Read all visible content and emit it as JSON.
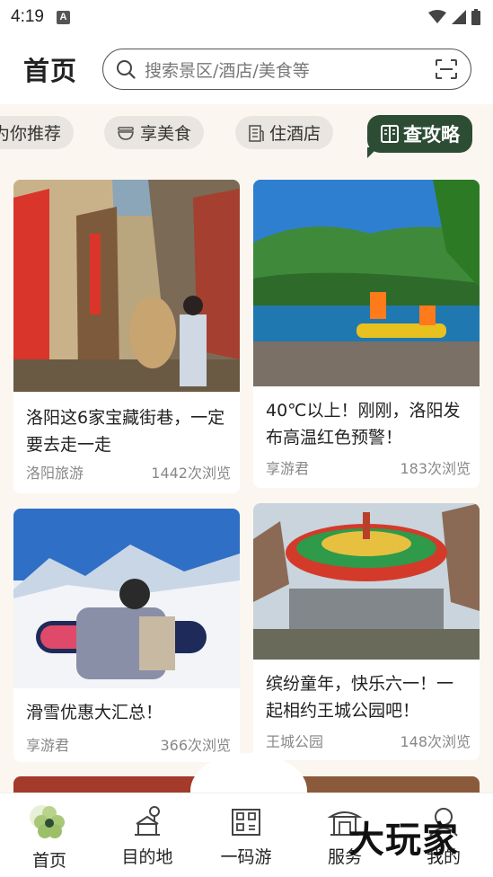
{
  "status_bar": {
    "time": "4:19",
    "notification_letter": "A"
  },
  "header": {
    "title": "首页",
    "search_placeholder": "搜索景区/酒店/美食等"
  },
  "chips": [
    {
      "label": "为你推荐",
      "icon": "recommend-icon"
    },
    {
      "label": "享美食",
      "icon": "food-bowl-icon"
    },
    {
      "label": "住酒店",
      "icon": "hotel-building-icon"
    },
    {
      "label": "查攻略",
      "icon": "guidebook-icon",
      "active": true
    }
  ],
  "cards": [
    {
      "title": "洛阳这6家宝藏街巷，一定要去走一走",
      "source": "洛阳旅游",
      "views": "1442次浏览"
    },
    {
      "title": "40℃以上！刚刚，洛阳发布高温红色预警！",
      "source": "享游君",
      "views": "183次浏览"
    },
    {
      "title": "滑雪优惠大汇总！",
      "source": "享游君",
      "views": "366次浏览"
    },
    {
      "title": "缤纷童年，快乐六一！一起相约王城公园吧！",
      "source": "王城公园",
      "views": "148次浏览"
    }
  ],
  "bottom_nav": [
    {
      "label": "首页",
      "icon": "home-flower-icon",
      "active": true
    },
    {
      "label": "目的地",
      "icon": "destination-icon"
    },
    {
      "label": "一码游",
      "icon": "qr-tour-icon"
    },
    {
      "label": "服务",
      "icon": "service-pavilion-icon"
    },
    {
      "label": "我的",
      "icon": "profile-icon"
    }
  ],
  "watermark": "大玩家",
  "colors": {
    "accent": "#2d4c34",
    "background": "#fbf7f0",
    "chip": "#e9e6e1"
  }
}
